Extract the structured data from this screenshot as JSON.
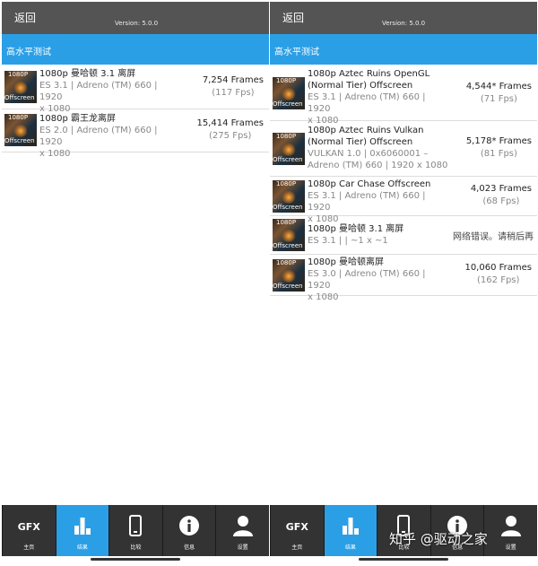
{
  "app": {
    "back_label": "返回",
    "version": "Version: 5.0.0",
    "section_title": "高水平测试"
  },
  "thumb_labels": {
    "res": "1080P",
    "mode": "Offscreen"
  },
  "left_results": [
    {
      "title": "1080p 曼哈顿 3.1 离屏",
      "line1": "ES 3.1 | Adreno (TM) 660 | 1920",
      "line2": "x 1080",
      "line3": "",
      "frames": "7,254 Frames",
      "fps": "(117 Fps)"
    },
    {
      "title": "1080p 霸王龙离屏",
      "line1": "ES 2.0 | Adreno (TM) 660 | 1920",
      "line2": "x 1080",
      "line3": "",
      "frames": "15,414 Frames",
      "fps": "(275 Fps)"
    }
  ],
  "right_results": [
    {
      "title": "1080p Aztec Ruins OpenGL",
      "title2": "(Normal Tier) Offscreen",
      "line1": "ES 3.1 | Adreno (TM) 660 | 1920",
      "line2": "x 1080",
      "frames": "4,544* Frames",
      "fps": "(71 Fps)"
    },
    {
      "title": "1080p Aztec Ruins Vulkan",
      "title2": "(Normal Tier) Offscreen",
      "line1": "VULKAN 1.0 | 0x6060001 –",
      "line2": "Adreno (TM) 660 | 1920 x 1080",
      "frames": "5,178* Frames",
      "fps": "(81 Fps)"
    },
    {
      "title": "1080p Car Chase Offscreen",
      "title2": "",
      "line1": "ES 3.1 | Adreno (TM) 660 | 1920",
      "line2": "x 1080",
      "frames": "4,023 Frames",
      "fps": "(68 Fps)"
    },
    {
      "title": "1080p 曼哈顿 3.1 离屏",
      "title2": "",
      "line1": "ES 3.1 | | ~1 x ~1",
      "line2": "",
      "error": "网络错误。请稍后再"
    },
    {
      "title": "1080p 曼哈顿离屏",
      "title2": "",
      "line1": "ES 3.0 | Adreno (TM) 660 | 1920",
      "line2": "x 1080",
      "frames": "10,060 Frames",
      "fps": "(162 Fps)"
    }
  ],
  "nav": {
    "gfx": "GFX",
    "home": "主页",
    "results": "结果",
    "compare": "比较",
    "info": "信息",
    "settings": "设置"
  },
  "watermark": "知乎 @驱动之家",
  "colors": {
    "accent": "#2b9fe6",
    "topbar": "#545454",
    "navbar": "#333333"
  }
}
